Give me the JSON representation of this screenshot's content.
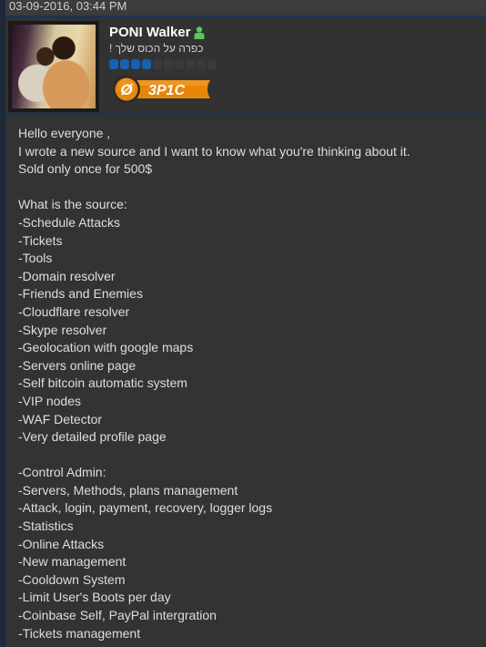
{
  "post": {
    "date": "03-09-2016, 03:44 PM",
    "author": {
      "username": "PONI Walker",
      "status_icon": "user-online-icon",
      "status_color": "#5ac85a",
      "user_title": "כפרה על הכוס שלך !",
      "reputation": {
        "filled": 4,
        "total": 10,
        "color": "#1661b0"
      },
      "rank_badge": {
        "label": "3P1C",
        "emblem": "Ø",
        "color": "#e8860c"
      }
    },
    "body_lines": [
      "Hello everyone ,",
      "I wrote a new source and I want to know what you're thinking about it.",
      "Sold only once for 500$",
      "",
      "What is the source:",
      "-Schedule Attacks",
      "-Tickets",
      "-Tools",
      "-Domain resolver",
      "-Friends and Enemies",
      "-Cloudflare resolver",
      "-Skype resolver",
      "-Geolocation with google maps",
      "-Servers online page",
      "-Self bitcoin automatic system",
      "-VIP nodes",
      "-WAF Detector",
      "-Very detailed profile page",
      "",
      "-Control Admin:",
      "-Servers, Methods, plans management",
      "-Attack, login, payment, recovery, logger logs",
      "-Statistics",
      "-Online Attacks",
      "-New management",
      "-Cooldown System",
      "-Limit User's Boots per day",
      "-Coinbase Self, PayPal intergration",
      "-Tickets management"
    ]
  }
}
